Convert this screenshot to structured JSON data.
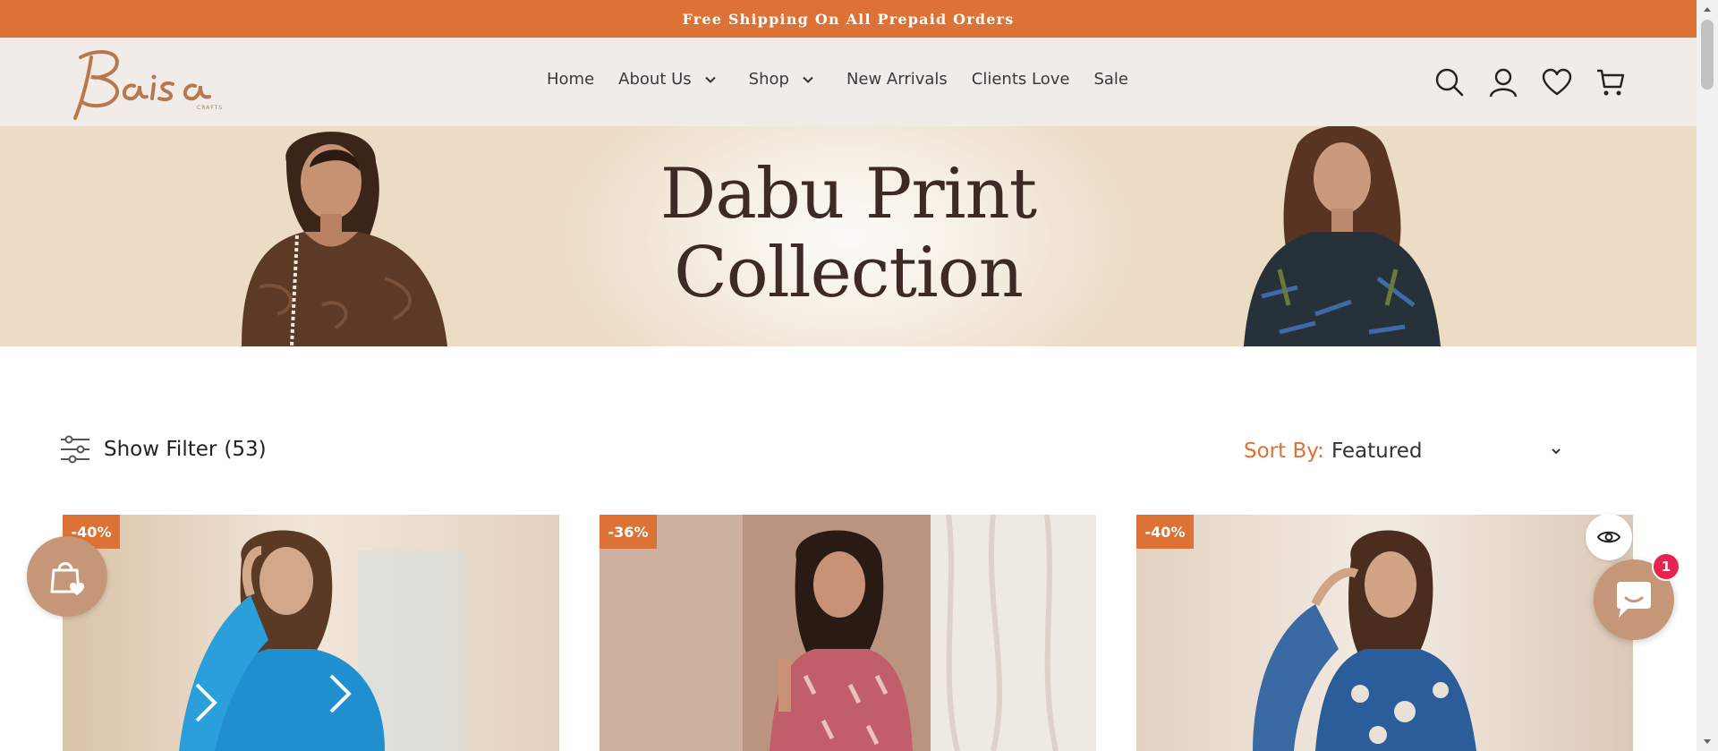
{
  "announcement": {
    "text": "Free Shipping On All Prepaid Orders"
  },
  "header": {
    "logo_alt": "Baisa Crafts",
    "nav": [
      {
        "label": "Home",
        "dropdown": false
      },
      {
        "label": "About Us",
        "dropdown": true
      },
      {
        "label": "Shop",
        "dropdown": true
      },
      {
        "label": "New Arrivals",
        "dropdown": false
      },
      {
        "label": "Clients Love",
        "dropdown": false
      },
      {
        "label": "Sale",
        "dropdown": false
      }
    ],
    "icons": [
      "search-icon",
      "account-icon",
      "wishlist-heart-icon",
      "cart-icon"
    ]
  },
  "banner": {
    "line1": "Dabu Print",
    "line2": "Collection"
  },
  "toolbar": {
    "filter_label": "Show Filter",
    "filter_count": "(53)",
    "sort_label": "Sort By:",
    "sort_value": "Featured"
  },
  "products": [
    {
      "discount": "-40%",
      "dress_color": "#1f8fcf"
    },
    {
      "discount": "-36%",
      "dress_color": "#c25e6a"
    },
    {
      "discount": "-40%",
      "dress_color": "#2c5d9b"
    }
  ],
  "chat": {
    "unread_count": "1"
  },
  "colors": {
    "accent": "#dd7236",
    "header_bg": "#f2ece9",
    "widget_bg": "#c59778",
    "badge_red": "#e8234f"
  }
}
